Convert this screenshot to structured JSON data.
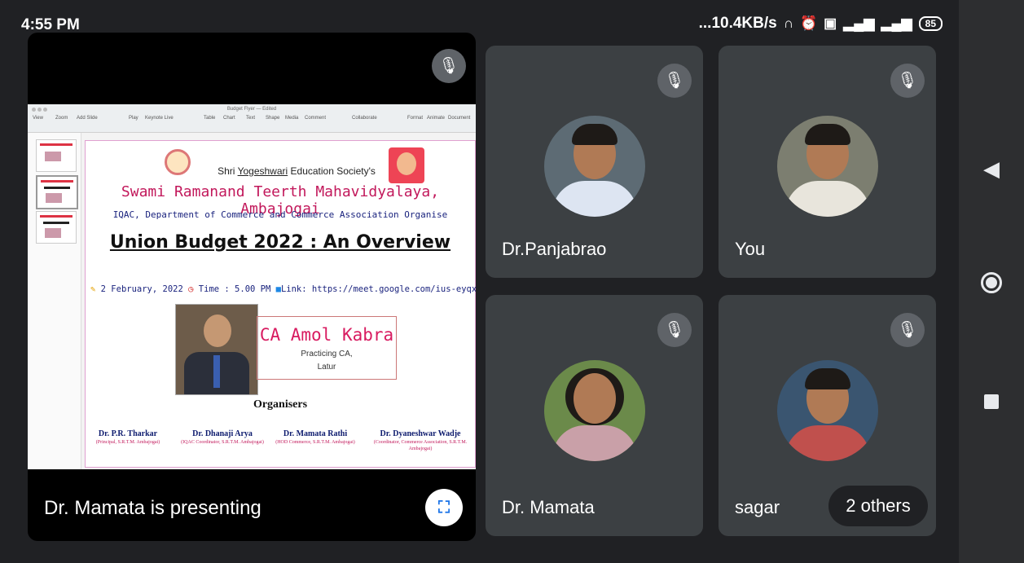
{
  "status_bar": {
    "time": "4:55 PM",
    "net_speed": "...10.4KB/s",
    "battery": "85",
    "icons": [
      "headphones-icon",
      "alarm-icon",
      "volte-icon",
      "signal-4g-icon",
      "signal-icon",
      "battery-icon"
    ]
  },
  "presentation": {
    "label": "Dr. Mamata is presenting",
    "fullscreen_icon": "fullscreen-icon",
    "mic_icon": "mic-off-icon",
    "app_title": "Budget Flyer — Edited",
    "toolbar_items": [
      "View",
      "Zoom",
      "Add Slide",
      "Play",
      "Keynote Live",
      "Table",
      "Chart",
      "Text",
      "Shape",
      "Media",
      "Comment",
      "Collaborate",
      "Format",
      "Animate",
      "Document"
    ]
  },
  "slide": {
    "society_prefix": "Shri ",
    "society_name": "Yogeshwari",
    "society_suffix": " Education Society's",
    "college": "Swami Ramanand Teerth Mahavidyalaya, Ambajogai",
    "department": "IQAC, Department of Commerce and Commerce Association Organise",
    "title": "Union Budget 2022 : An Overview",
    "date": "2 February, 2022",
    "time": "Time : 5.00 PM",
    "link": "Link: https://meet.google.com/ius-eyqx-jsb",
    "speaker_name": "CA Amol Kabra",
    "speaker_role": "Practicing CA,",
    "speaker_city": "Latur",
    "organisers_title": "Organisers",
    "organisers": [
      {
        "name": "Dr. P.R. Tharkar",
        "role": "(Principal, S.R.T.M. Ambajogai)"
      },
      {
        "name": "Dr. Dhanaji Arya",
        "role": "(IQAC Coordinator, S.R.T.M. Ambajogai)"
      },
      {
        "name": "Dr. Mamata Rathi",
        "role": "(HOD Commerce, S.R.T.M. Ambajogai)"
      },
      {
        "name": "Dr. Dyaneshwar Wadje",
        "role": "(Coordinator, Commerce Association, S.R.T.M. Ambajogai)"
      }
    ]
  },
  "participants": [
    {
      "name": "Dr.Panjabrao",
      "muted": true
    },
    {
      "name": "You",
      "muted": true
    },
    {
      "name": "Dr. Mamata",
      "muted": true
    },
    {
      "name": "sagar",
      "muted": true
    }
  ],
  "others_label": "2 others",
  "nav": {
    "back": "back-icon",
    "home": "home-icon",
    "recents": "recents-icon"
  }
}
